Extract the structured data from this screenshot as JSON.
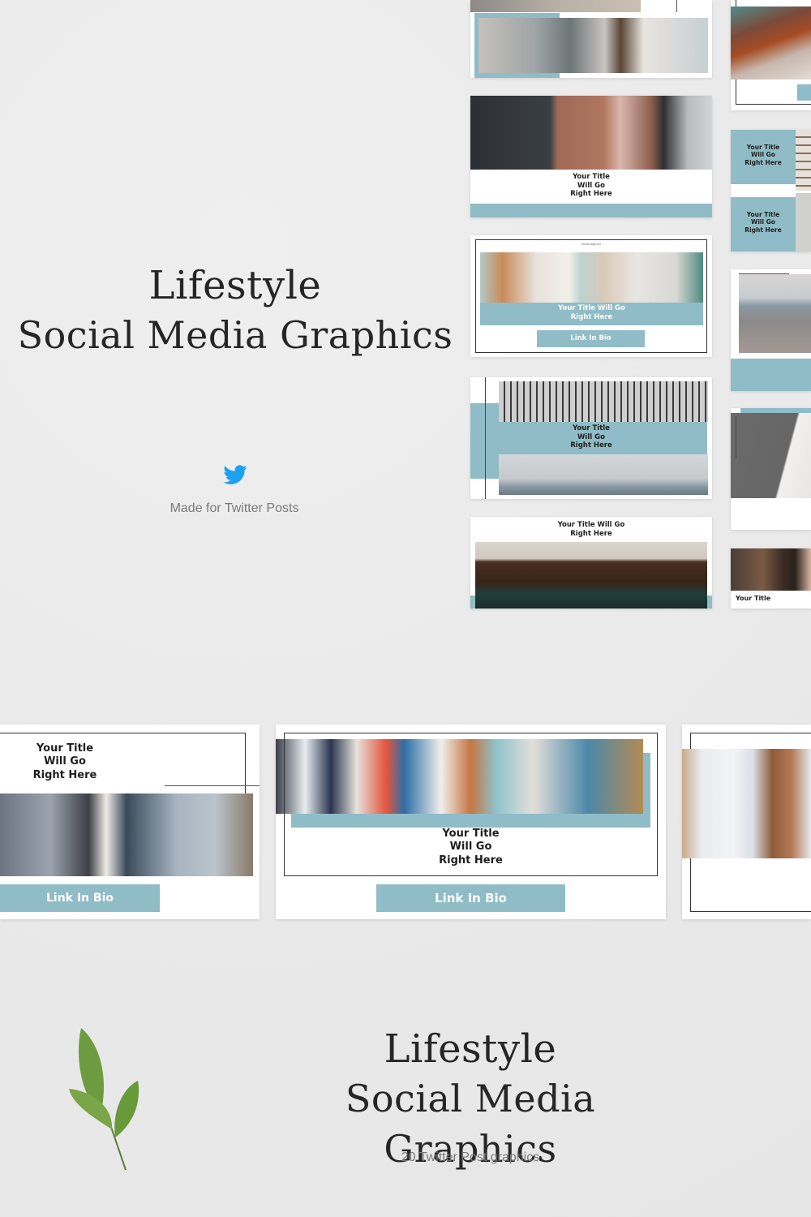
{
  "hero_top": {
    "title_line1": "Lifestyle",
    "title_line2": "Social Media Graphics",
    "icon": "twitter-bird-icon",
    "subtitle": "Made for Twitter Posts"
  },
  "hero_bottom": {
    "title_line1": "Lifestyle",
    "title_line2": "Social Media Graphics",
    "subtitle": "20 Twitter Post graphics",
    "decoration": "green-leaf-sprig"
  },
  "template_text": {
    "title_3line": [
      "Your Title",
      "Will Go",
      "Right Here"
    ],
    "title_2line": [
      "Your Title Will Go",
      "Right Here"
    ],
    "link": "Link In Bio",
    "hashtag": "#hashtaghere"
  },
  "colors": {
    "background": "#ececec",
    "accent_teal": "#8fbcc6",
    "twitter_blue": "#1da1f2",
    "text_dark": "#262626"
  }
}
